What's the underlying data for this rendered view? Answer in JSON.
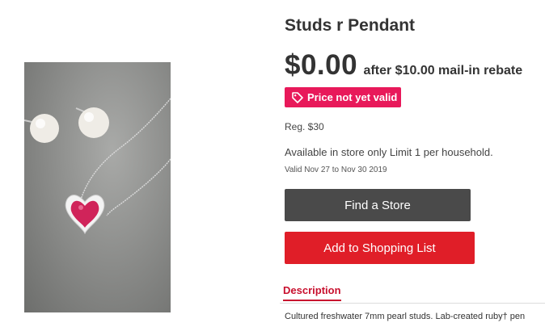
{
  "product": {
    "title": "Studs r Pendant",
    "price": "$0.00",
    "rebate_text": "after $10.00 mail-in rebate",
    "badge": "Price not yet valid",
    "regular_price": "Reg. $30",
    "availability": "Available in store only Limit 1 per household.",
    "valid_dates": "Valid Nov 27 to Nov 30 2019",
    "image_icon": "pearl-studs-heart-pendant-image"
  },
  "buttons": {
    "find_store": "Find a Store",
    "add_list": "Add to Shopping List"
  },
  "tabs": {
    "description_label": "Description",
    "description_text": "Cultured freshwater 7mm pearl studs. Lab-created ruby† pen"
  },
  "colors": {
    "badge_bg": "#e8195a",
    "primary_red": "#e01e28",
    "dark_button": "#4a4a4a"
  }
}
